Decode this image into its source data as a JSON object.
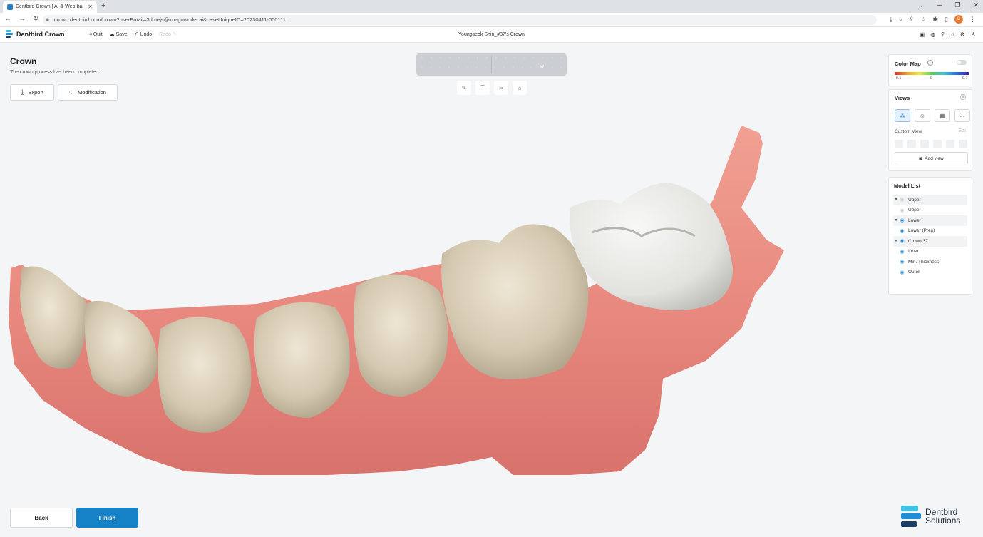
{
  "browser": {
    "tab_title": "Dentbird Crown | AI & Web-ba",
    "url": "crown.dentbird.com/crown?userEmail=3dmejs@imagoworks.ai&caseUniqueID=20230411-000111",
    "profile_initials": "G"
  },
  "header": {
    "brand": "Dentbird Crown",
    "quit": "Quit",
    "save": "Save",
    "undo": "Undo",
    "redo": "Redo",
    "patient": "Youngseok Shin_#37's Crown"
  },
  "step": {
    "title": "Crown",
    "description": "The crown process has been completed.",
    "export_label": "Export",
    "modification_label": "Modification"
  },
  "tooth_chart": {
    "selected": "37"
  },
  "color_map": {
    "title": "Color Map",
    "min": "-0.1",
    "mid": "0",
    "max": "0.1"
  },
  "views": {
    "title": "Views",
    "custom_view": "Custom View",
    "edit": "Edit",
    "add_view": "Add view"
  },
  "model_list": {
    "title": "Model List",
    "items": [
      {
        "label": "Upper"
      },
      {
        "label": "Upper"
      },
      {
        "label": "Lower"
      },
      {
        "label": "Lower (Prep)"
      },
      {
        "label": "Crown 37"
      },
      {
        "label": "Inner"
      },
      {
        "label": "Min. Thickness"
      },
      {
        "label": "Outer"
      }
    ]
  },
  "footer": {
    "back": "Back",
    "finish": "Finish",
    "logo_line1": "Dentbird",
    "logo_line2": "Solutions"
  },
  "colors": {
    "accent": "#1582c8",
    "gum": "#e98a80",
    "tooth": "#d8cdb8",
    "crown": "#e8e8e6"
  }
}
